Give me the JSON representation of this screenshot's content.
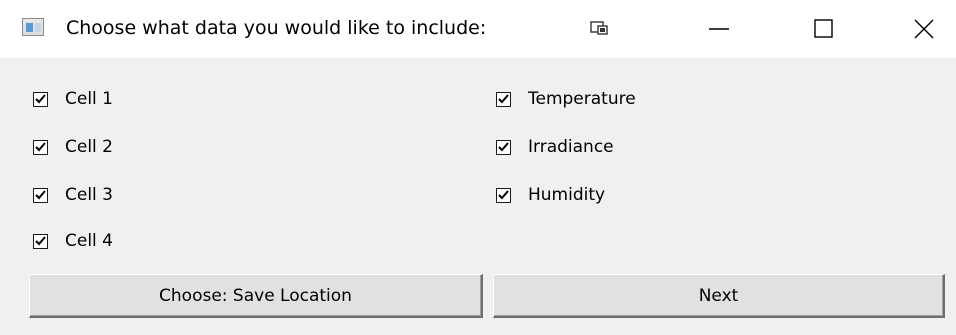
{
  "window": {
    "title": "Choose what data you would like to include:"
  },
  "titlebar_buttons": {
    "minimize_icon": "minimize-icon",
    "maximize_icon": "maximize-icon",
    "close_icon": "close-icon"
  },
  "left_checkboxes": [
    {
      "label": "Cell 1",
      "checked": true
    },
    {
      "label": "Cell 2",
      "checked": true
    },
    {
      "label": "Cell 3",
      "checked": true
    },
    {
      "label": "Cell 4",
      "checked": true
    }
  ],
  "right_checkboxes": [
    {
      "label": "Temperature",
      "checked": true
    },
    {
      "label": "Irradiance",
      "checked": true
    },
    {
      "label": "Humidity",
      "checked": true
    }
  ],
  "buttons": {
    "save_location": "Choose: Save Location",
    "next": "Next"
  }
}
